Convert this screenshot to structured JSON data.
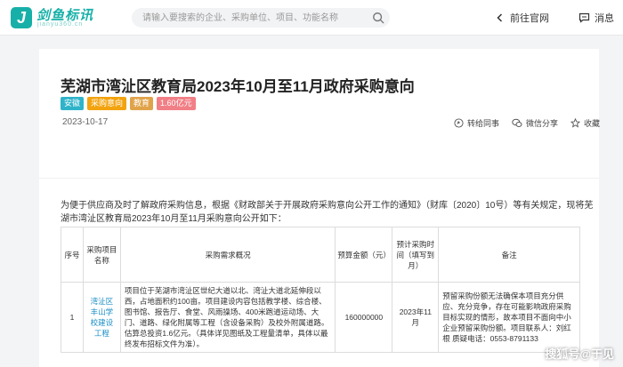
{
  "header": {
    "logo_text": "剑鱼标讯",
    "logo_sub": "jianyu360.cn",
    "search_placeholder": "请输入要搜索的企业、采购单位、项目、功能名称",
    "official_site": "前往官网",
    "message": "消息"
  },
  "article": {
    "title": "芜湖市湾沚区教育局2023年10月至11月政府采购意向",
    "tags": [
      "安徽",
      "采购意向",
      "教育",
      "1.60亿元"
    ],
    "date": "2023-10-17",
    "actions": {
      "share_colleague": "转给同事",
      "wechat_share": "微信分享",
      "favorite": "收藏"
    },
    "intro": "为便于供应商及时了解政府采购信息，根据《财政部关于开展政府采购意向公开工作的通知》（财库〔2020〕10号）等有关规定，现将芜湖市湾沚区教育局2023年10月至11月采购意向公开如下：",
    "table": {
      "headers": [
        "序号",
        "采购项目名称",
        "采购需求概况",
        "预算金额（元）",
        "预计采购时间（填写到月）",
        "备注"
      ],
      "rows": [
        {
          "no": "1",
          "name": "湾沚区丰山学校建设工程",
          "desc": "项目位于芜湖市湾沚区世纪大道以北、湾沚大道北延伸段以西，占地面积约100亩。项目建设内容包括教学楼、综合楼、图书馆、报告厅、食堂、风雨操场、400米跑道运动场、大门、道路、绿化附属等工程（含设备采购）及校外附属道路。估算总投资1.6亿元。（具体详见图纸及工程量清单，具体以最终发布招标文件为准）。",
          "budget": "160000000",
          "time": "2023年11月",
          "remark": "预留采购份额无法确保本项目充分供应、充分竞争，存在可能影响政府采购目标实现的情形，故本项目不面向中小企业预留采购份额。项目联系人：刘红根 质疑电话：0553-8791133"
        }
      ]
    }
  },
  "watermark": "搜狐号@于见"
}
